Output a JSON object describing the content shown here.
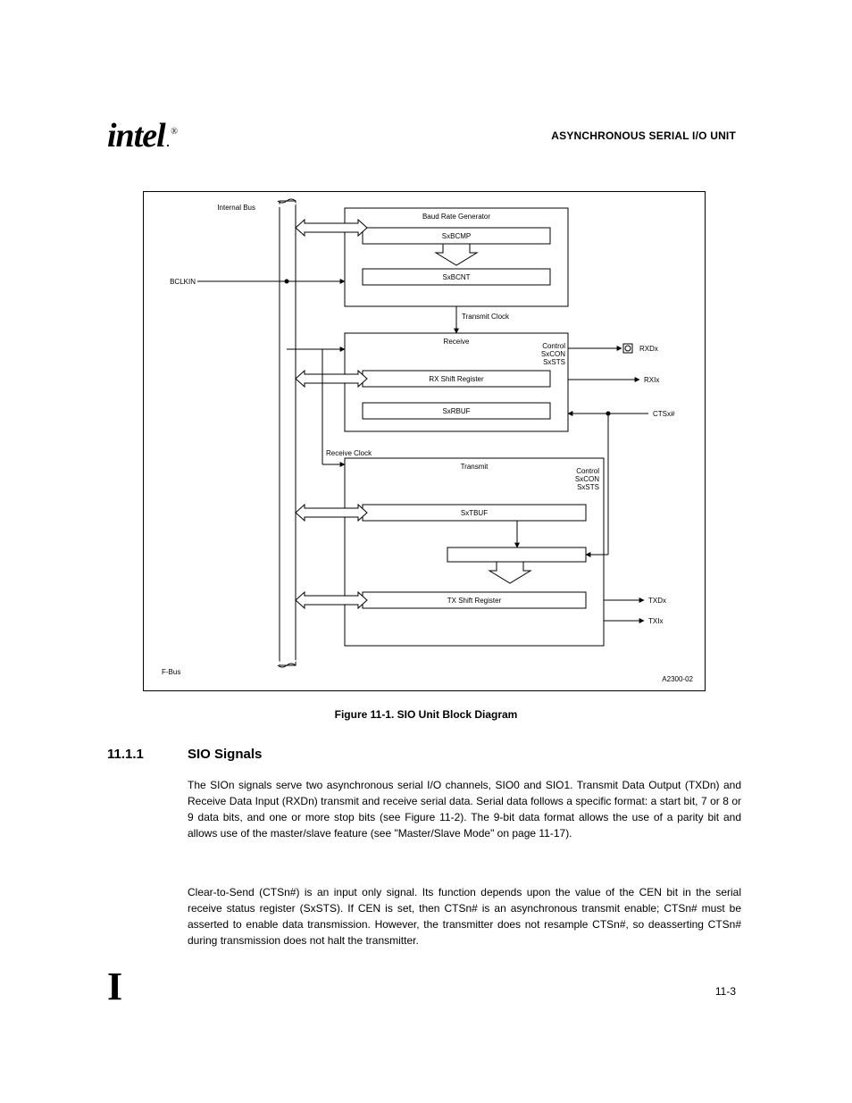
{
  "header": {
    "right": "ASYNCHRONOUS SERIAL I/O UNIT"
  },
  "logo": {
    "text": "intel",
    "dot": ".",
    "reg": "®"
  },
  "diagram": {
    "bus_label_top": "Internal Bus",
    "bus_label_left": "F-Bus",
    "baud": {
      "title": "Baud Rate Generator",
      "compare": "SxBCMP",
      "counter": "SxBCNT",
      "signals": {
        "bclkin": "BCLKIN",
        "toTx": "Transmit Clock",
        "toRx": "Receive Clock"
      }
    },
    "rx": {
      "title": "Receive",
      "ctrl": "Control\nSxCON\nSxSTS",
      "rbuf": "SxRBUF",
      "shift": "RX Shift Register",
      "signals": {
        "rxd": "RXDx",
        "rxi": "RXIx",
        "cts": "CTSx#"
      }
    },
    "tx": {
      "title": "Transmit",
      "ctrl": "Control\nSxCON\nSxSTS",
      "tbuf": "SxTBUF",
      "shift": "TX Shift Register",
      "signals": {
        "txd": "TXDx",
        "txi": "TXIx"
      }
    },
    "note_id": "A2300-02"
  },
  "caption": "Figure 11-1. SIO Unit Block Diagram",
  "section": {
    "num": "11.1.1",
    "title": "SIO Signals"
  },
  "paras": {
    "p1": "The SIOn signals serve two asynchronous serial I/O channels, SIO0 and SIO1. Transmit Data Output (TXDn) and Receive Data Input (RXDn) transmit and receive serial data. Serial data follows a specific format: a start bit, 7 or 8 or 9 data bits, and one or more stop bits (see Figure 11-2). The 9-bit data format allows the use of a parity bit and allows use of the master/slave feature (see \"Master/Slave Mode\" on page 11-17).",
    "p2": "Clear-to-Send (CTSn#) is an input only signal. Its function depends upon the value of the CEN bit in the serial receive status register (SxSTS). If CEN is set, then CTSn# is an asynchronous transmit enable; CTSn# must be asserted to enable data transmission. However, the transmitter does not resample CTSn#, so deasserting CTSn# during transmission does not halt the transmitter."
  },
  "footer": {
    "left": "I",
    "right": "11-3"
  }
}
